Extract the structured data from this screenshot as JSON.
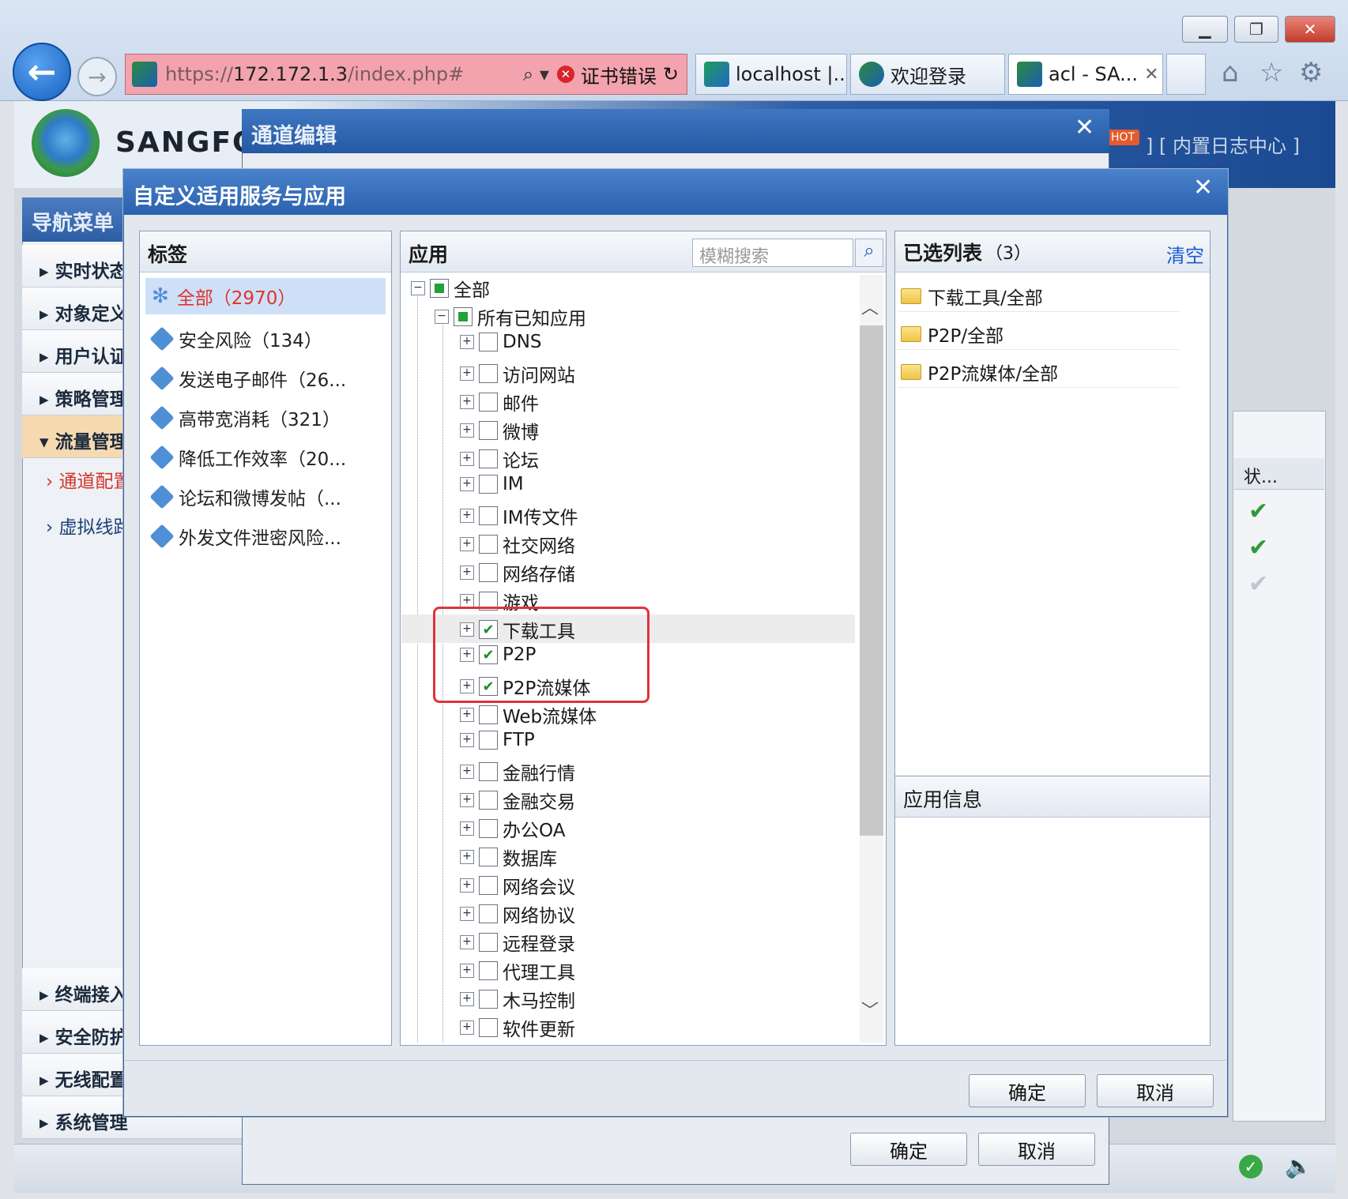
{
  "browser": {
    "url_prefix": "https://",
    "url_host": "172.172.1.3",
    "url_path": "/index.php#",
    "cert_error": "证书错误",
    "tabs": [
      {
        "label": "localhost |..."
      },
      {
        "label": "欢迎登录"
      },
      {
        "label": "acl - SA..."
      }
    ]
  },
  "app": {
    "brand": "SANGFOR",
    "hot_badge": "HOT",
    "log_center_link": "] [ 内置日志中心 ]",
    "nav_title": "导航菜单",
    "nav_items": [
      "实时状态",
      "对象定义",
      "用户认证",
      "策略管理",
      "流量管理",
      "终端接入",
      "安全防护",
      "无线配置",
      "系统管理"
    ],
    "nav_sub_items": [
      "通道配置",
      "虚拟线路"
    ],
    "status_column": "状..."
  },
  "channel_dialog": {
    "title": "通道编辑",
    "ok": "确定",
    "cancel": "取消"
  },
  "custom_dialog": {
    "title": "自定义适用服务与应用",
    "tags_header": "标签",
    "tags": [
      {
        "label": "全部（2970）",
        "selected": true
      },
      {
        "label": "安全风险（134）"
      },
      {
        "label": "发送电子邮件（26..."
      },
      {
        "label": "高带宽消耗（321）"
      },
      {
        "label": "降低工作效率（20..."
      },
      {
        "label": "论坛和微博发帖（..."
      },
      {
        "label": "外发文件泄密风险..."
      }
    ],
    "apps_header": "应用",
    "search_placeholder": "模糊搜索",
    "tree_root": "全部",
    "tree_known": "所有已知应用",
    "tree_items": [
      {
        "label": "DNS",
        "checked": false
      },
      {
        "label": "访问网站",
        "checked": false
      },
      {
        "label": "邮件",
        "checked": false
      },
      {
        "label": "微博",
        "checked": false
      },
      {
        "label": "论坛",
        "checked": false
      },
      {
        "label": "IM",
        "checked": false
      },
      {
        "label": "IM传文件",
        "checked": false
      },
      {
        "label": "社交网络",
        "checked": false
      },
      {
        "label": "网络存储",
        "checked": false
      },
      {
        "label": "游戏",
        "checked": false
      },
      {
        "label": "下载工具",
        "checked": true
      },
      {
        "label": "P2P",
        "checked": true
      },
      {
        "label": "P2P流媒体",
        "checked": true
      },
      {
        "label": "Web流媒体",
        "checked": false
      },
      {
        "label": "FTP",
        "checked": false
      },
      {
        "label": "金融行情",
        "checked": false
      },
      {
        "label": "金融交易",
        "checked": false
      },
      {
        "label": "办公OA",
        "checked": false
      },
      {
        "label": "数据库",
        "checked": false
      },
      {
        "label": "网络会议",
        "checked": false
      },
      {
        "label": "网络协议",
        "checked": false
      },
      {
        "label": "远程登录",
        "checked": false
      },
      {
        "label": "代理工具",
        "checked": false
      },
      {
        "label": "木马控制",
        "checked": false
      },
      {
        "label": "软件更新",
        "checked": false
      }
    ],
    "selected_header": "已选列表",
    "selected_count": "（3）",
    "clear": "清空",
    "selected_items": [
      "下载工具/全部",
      "P2P/全部",
      "P2P流媒体/全部"
    ],
    "app_info_header": "应用信息",
    "ok": "确定",
    "cancel": "取消"
  },
  "colors": {
    "highlight_box": "#e0323c",
    "title_bar": "#2a61ad",
    "checked": "#1b8f2d"
  }
}
